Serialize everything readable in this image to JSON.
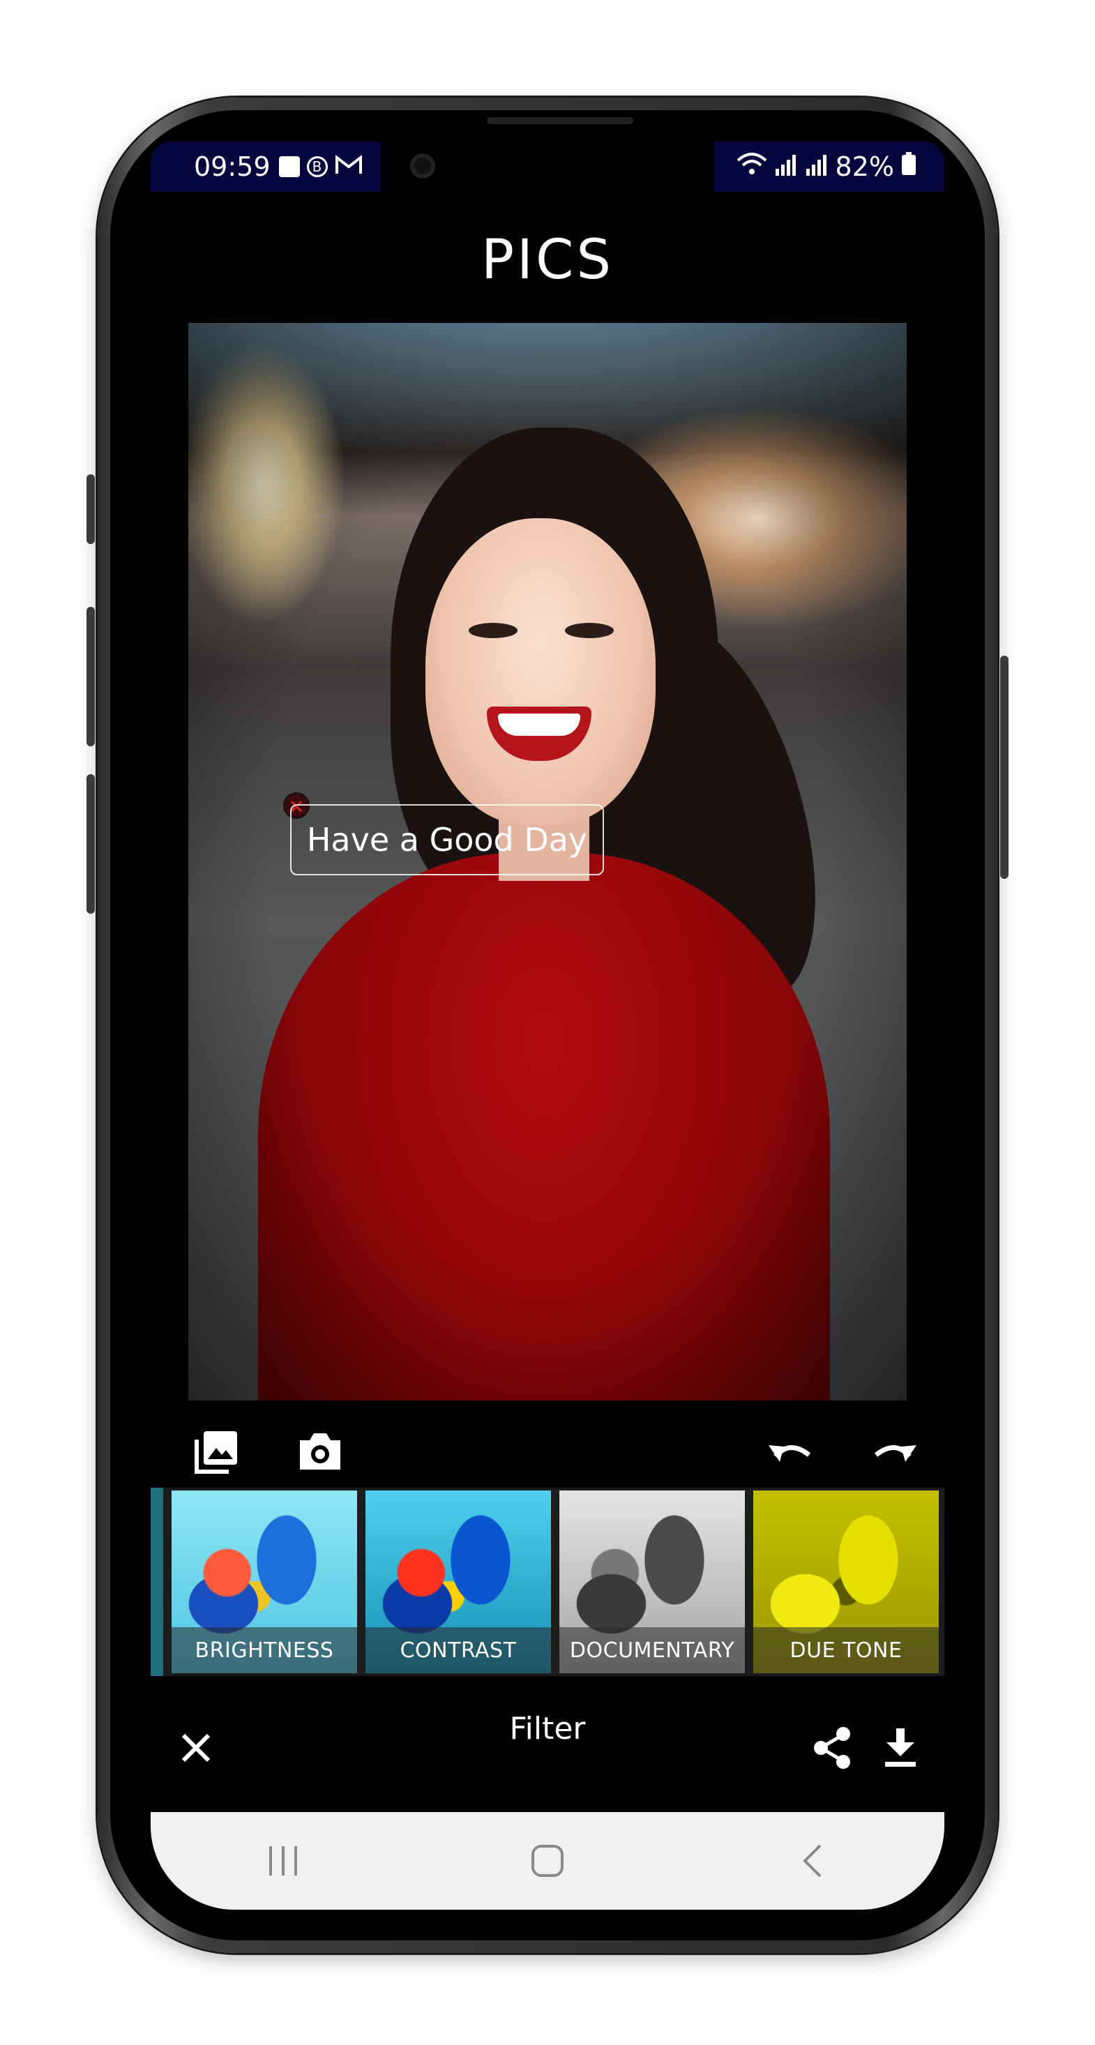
{
  "status_bar": {
    "time": "09:59",
    "battery": "82%",
    "icons_left": [
      "image-icon",
      "b-icon",
      "gmail-icon"
    ],
    "icons_right": [
      "wifi-icon",
      "signal-icon",
      "signal-icon",
      "battery-icon"
    ]
  },
  "app": {
    "title": "PICS"
  },
  "photo": {
    "text_sticker": "Have a Good Day"
  },
  "tools": {
    "left": [
      "gallery-icon",
      "camera-icon"
    ],
    "right": [
      "undo-icon",
      "redo-icon"
    ]
  },
  "filters": [
    {
      "label": "BRIGHTNESS",
      "tint": "#2fb8d6"
    },
    {
      "label": "CONTRAST",
      "tint": "#1f95b8"
    },
    {
      "label": "DOCUMENTARY",
      "tint": "#9a9a9a"
    },
    {
      "label": "DUE TONE",
      "tint": "#c9c500"
    }
  ],
  "bottom_bar": {
    "title": "Filter",
    "left_icon": "close-icon",
    "right_icons": [
      "share-icon",
      "download-icon"
    ]
  },
  "nav_bar": [
    "recent-apps-icon",
    "home-icon",
    "back-icon"
  ],
  "colors": {
    "status_bar_bg": "#05063d",
    "screen_bg": "#000000",
    "shirt_red": "#a00a0e",
    "nav_bar_bg": "#f1f1f1"
  }
}
